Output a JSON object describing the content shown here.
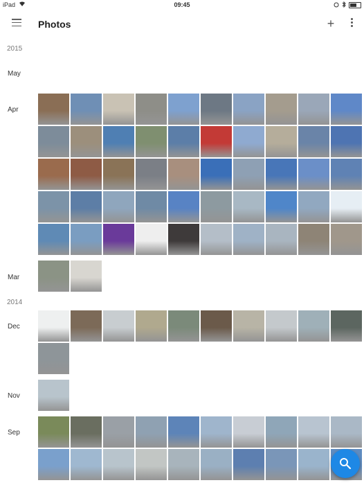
{
  "status_bar": {
    "carrier": "iPad",
    "time": "09:45"
  },
  "app_bar": {
    "title": "Photos",
    "menu_icon": "menu-icon",
    "add_icon": "add-icon",
    "more_icon": "more-vert-icon"
  },
  "timeline": {
    "year_2015": "2015",
    "may": "May",
    "apr": "Apr",
    "mar": "Mar",
    "year_2014": "2014",
    "dec": "Dec",
    "nov": "Nov",
    "sep": "Sep"
  },
  "fab": {
    "icon": "search-icon",
    "color": "#1e88e5"
  },
  "photos": {
    "apr": [
      "#8a6e55",
      "#6f8fb5",
      "#c9c2b4",
      "#8e8e88",
      "#7ea1cf",
      "#6d7884",
      "#8aa3c4",
      "#a49c8e",
      "#9aa7b8",
      "#5f88c8",
      "#7d8c9a",
      "#9c8f7c",
      "#4f7fb3",
      "#7f8f70",
      "#5c7ea8",
      "#c33a36",
      "#8faad0",
      "#b5ad9b",
      "#6a84a8",
      "#4e74b2",
      "#9a6b4d",
      "#8e5b45",
      "#8a7357",
      "#7b7f86",
      "#a88f7e",
      "#3a6fb8",
      "#8ea0b4",
      "#4876b8",
      "#6b8fc8",
      "#5f82b4",
      "#7c93a8",
      "#5d7ea6",
      "#8fa6bd",
      "#6f8aa5",
      "#5883c4",
      "#8d9aa0",
      "#a8b8c4",
      "#4f86c9",
      "#91a8c0",
      "#e6eef4",
      "#5f8ab5",
      "#7a9dc1",
      "#6a3a9a",
      "#eeeeee",
      "#3e3a3a",
      "#b4bec8",
      "#9fb2c6",
      "#a9b5c0",
      "#8e8476",
      "#a0978b"
    ],
    "mar": [
      "#8b9385",
      "#d8d6d0"
    ],
    "dec": [
      "#eef0f0",
      "#7c6a58",
      "#c8cdd0",
      "#b0a98e",
      "#7b8a7a",
      "#6b5a4a",
      "#b8b4a6",
      "#c4c9cc",
      "#9fb0b8",
      "#5c6660",
      "#8e9599"
    ],
    "nov": [
      "#b8c4cc"
    ],
    "sep": [
      "#7a8a5a",
      "#6a6e60",
      "#9aa0a6",
      "#8fa1b2",
      "#5d84b8",
      "#9fb5cc",
      "#c8cdd4",
      "#8fa6b8",
      "#b8c4d0",
      "#aab8c6",
      "#7aa0cc",
      "#9fb8d0",
      "#b8c4cc",
      "#c2c6c4",
      "#a8b4bc",
      "#9ab0c4",
      "#5d7fb0",
      "#7a96b8",
      "#9ab4cc",
      "#5f8cc0"
    ]
  }
}
